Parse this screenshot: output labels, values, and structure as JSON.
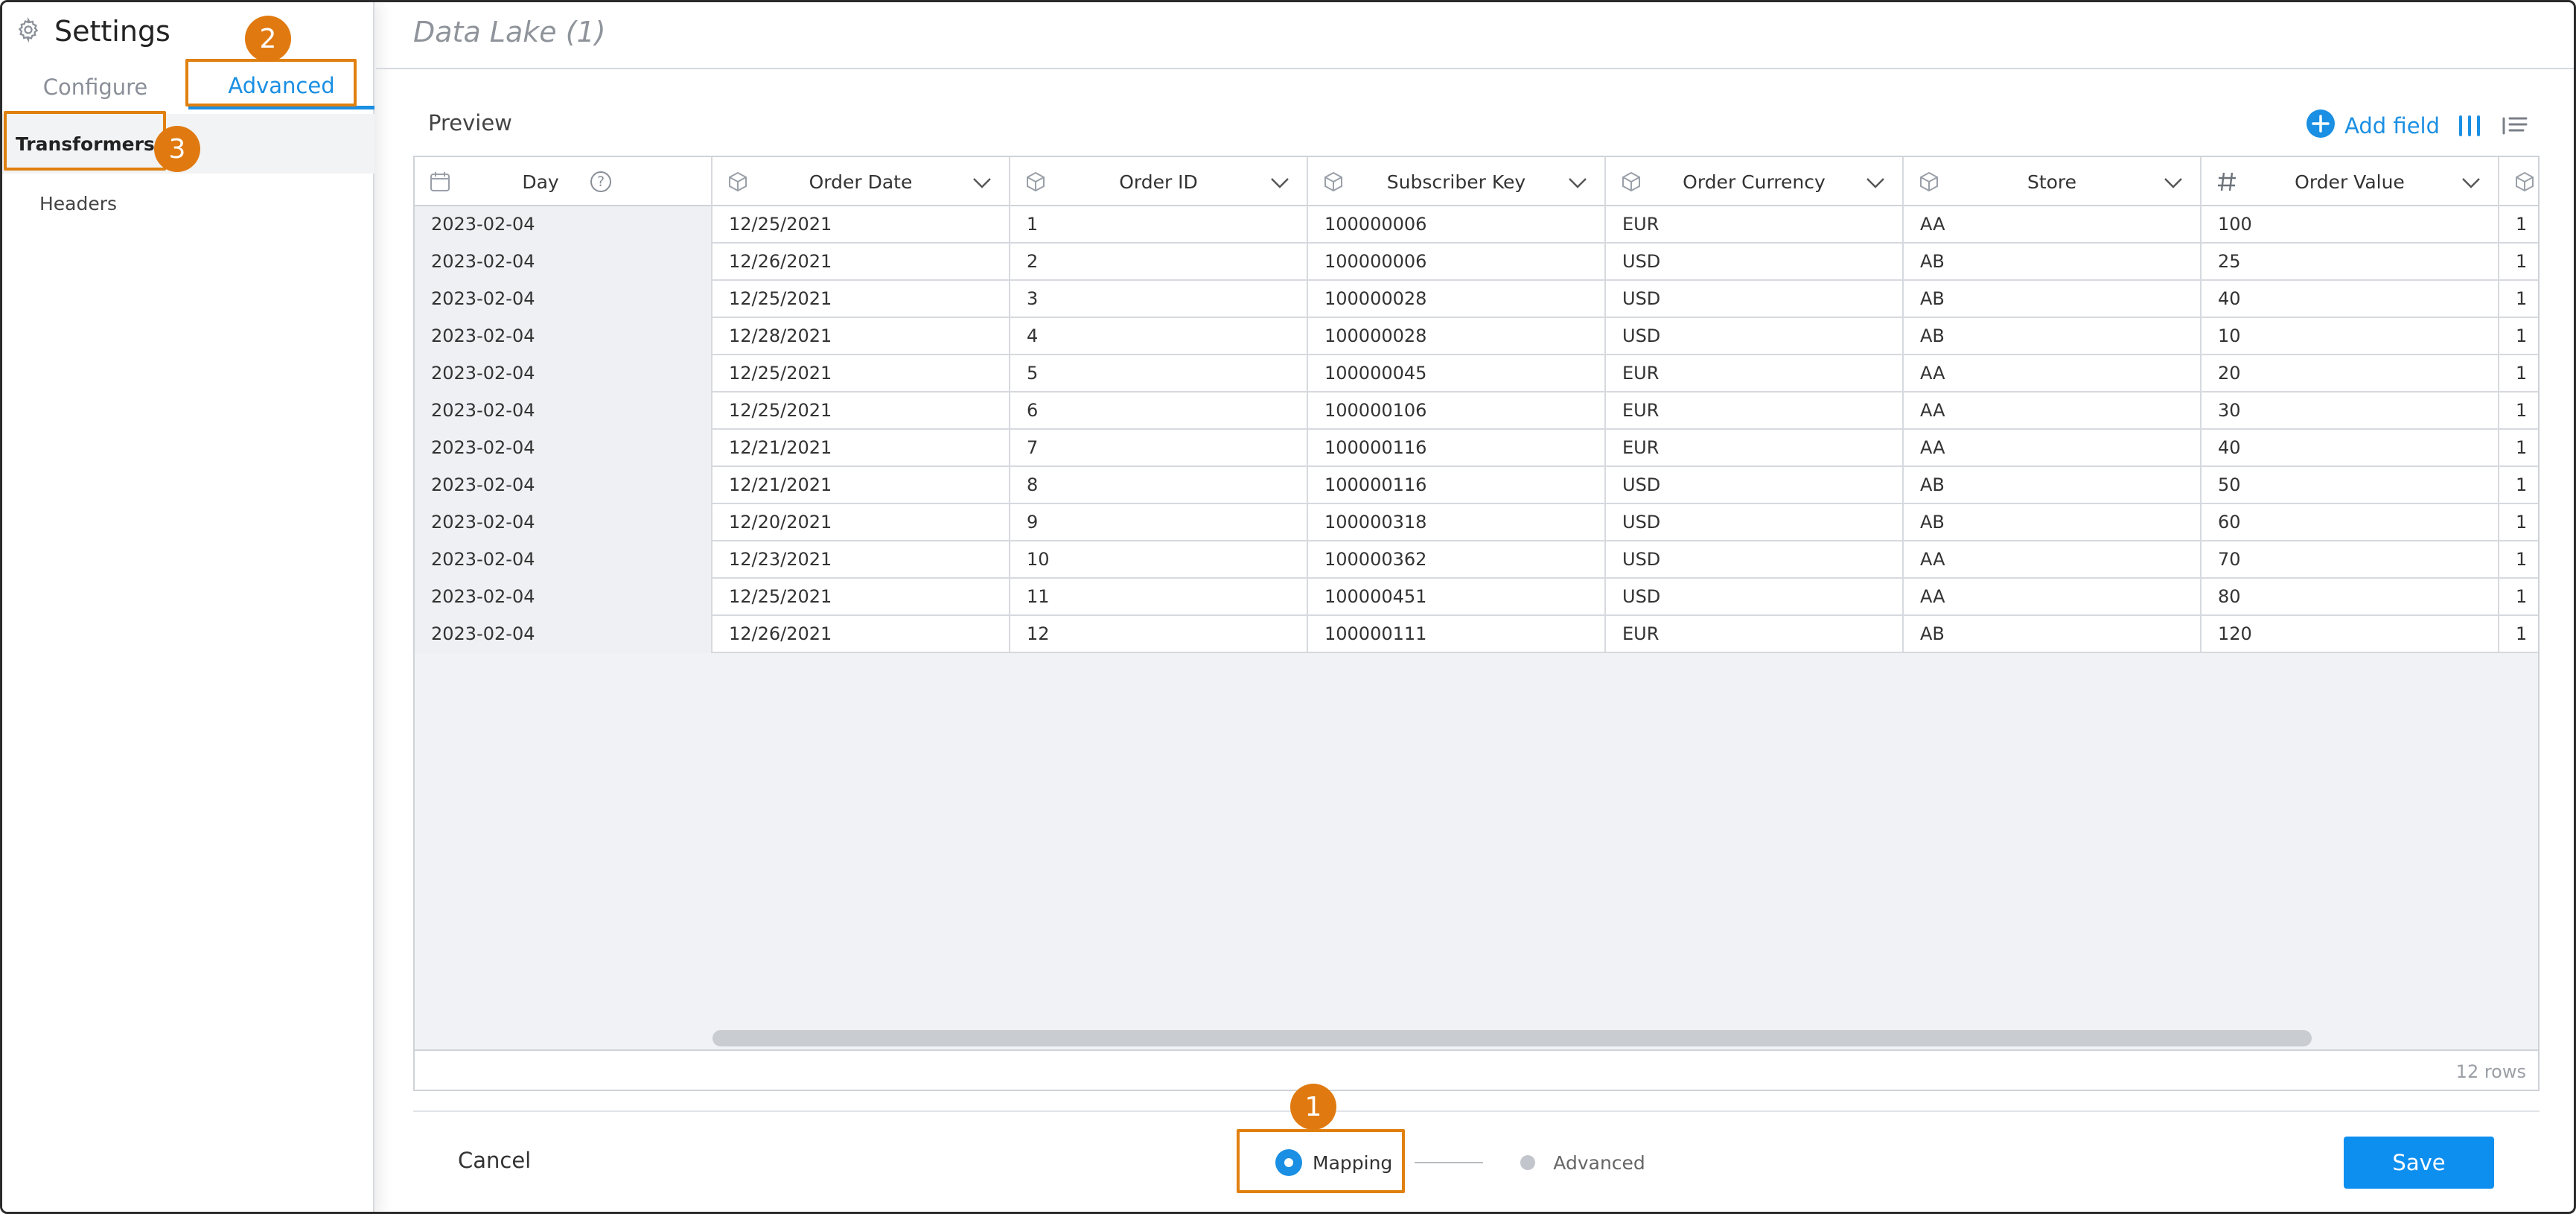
{
  "sidebar": {
    "title": "Settings",
    "tabs": [
      {
        "label": "Configure",
        "active": false
      },
      {
        "label": "Advanced",
        "active": true
      }
    ],
    "items": [
      {
        "label": "Transformers",
        "selected": true
      },
      {
        "label": "Headers",
        "selected": false
      }
    ]
  },
  "main": {
    "title": "Data Lake (1)",
    "preview_label": "Preview",
    "add_field_label": "Add field",
    "row_count": "12 rows"
  },
  "table": {
    "columns": [
      {
        "name": "Day",
        "type": "date",
        "help": "?"
      },
      {
        "name": "Order Date",
        "type": "text"
      },
      {
        "name": "Order ID",
        "type": "text"
      },
      {
        "name": "Subscriber Key",
        "type": "text"
      },
      {
        "name": "Order Currency",
        "type": "text"
      },
      {
        "name": "Store",
        "type": "text"
      },
      {
        "name": "Order Value",
        "type": "number"
      },
      {
        "name": "",
        "type": "text"
      }
    ],
    "rows": [
      [
        "2023-02-04",
        "12/25/2021",
        "1",
        "100000006",
        "EUR",
        "AA",
        "100",
        "1"
      ],
      [
        "2023-02-04",
        "12/26/2021",
        "2",
        "100000006",
        "USD",
        "AB",
        "25",
        "1"
      ],
      [
        "2023-02-04",
        "12/25/2021",
        "3",
        "100000028",
        "USD",
        "AB",
        "40",
        "1"
      ],
      [
        "2023-02-04",
        "12/28/2021",
        "4",
        "100000028",
        "USD",
        "AB",
        "10",
        "1"
      ],
      [
        "2023-02-04",
        "12/25/2021",
        "5",
        "100000045",
        "EUR",
        "AA",
        "20",
        "1"
      ],
      [
        "2023-02-04",
        "12/25/2021",
        "6",
        "100000106",
        "EUR",
        "AA",
        "30",
        "1"
      ],
      [
        "2023-02-04",
        "12/21/2021",
        "7",
        "100000116",
        "EUR",
        "AA",
        "40",
        "1"
      ],
      [
        "2023-02-04",
        "12/21/2021",
        "8",
        "100000116",
        "USD",
        "AB",
        "50",
        "1"
      ],
      [
        "2023-02-04",
        "12/20/2021",
        "9",
        "100000318",
        "USD",
        "AB",
        "60",
        "1"
      ],
      [
        "2023-02-04",
        "12/23/2021",
        "10",
        "100000362",
        "USD",
        "AA",
        "70",
        "1"
      ],
      [
        "2023-02-04",
        "12/25/2021",
        "11",
        "100000451",
        "USD",
        "AA",
        "80",
        "1"
      ],
      [
        "2023-02-04",
        "12/26/2021",
        "12",
        "100000111",
        "EUR",
        "AB",
        "120",
        "1"
      ]
    ]
  },
  "footer": {
    "cancel_label": "Cancel",
    "steps": [
      {
        "label": "Mapping",
        "active": true
      },
      {
        "label": "Advanced",
        "active": false
      }
    ],
    "save_label": "Save"
  },
  "annotations": [
    {
      "number": "1"
    },
    {
      "number": "2"
    },
    {
      "number": "3"
    }
  ],
  "colors": {
    "accent": "#1a8fe3",
    "save_button": "#0d8ff0",
    "annotation": "#e07a10"
  },
  "icons": [
    "gear-icon",
    "calendar-icon",
    "cube-icon",
    "hash-icon",
    "chevron-down-icon",
    "plus-circle-icon",
    "columns-icon",
    "list-icon",
    "help-icon"
  ]
}
